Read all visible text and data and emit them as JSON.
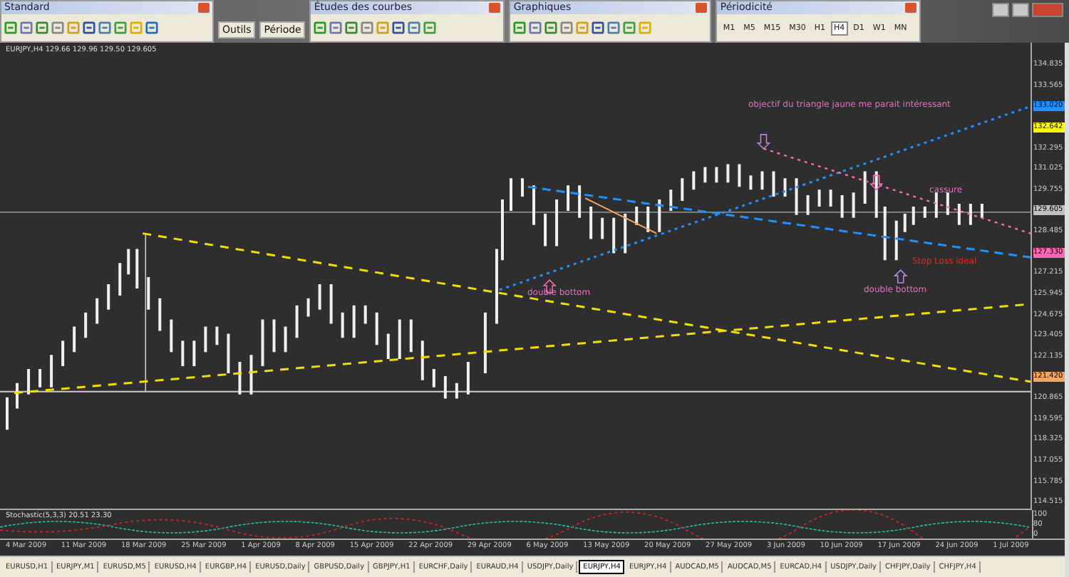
{
  "toolbars": [
    {
      "title": "Standard",
      "kind": "icons"
    },
    {
      "title": "Études des courbes",
      "kind": "icons"
    },
    {
      "title": "Graphiques",
      "kind": "icons"
    },
    {
      "title": "Périodicité",
      "kind": "periods",
      "periods": [
        {
          "label": "M1",
          "selected": false
        },
        {
          "label": "M5",
          "selected": false
        },
        {
          "label": "M15",
          "selected": false
        },
        {
          "label": "M30",
          "selected": false
        },
        {
          "label": "H1",
          "selected": false
        },
        {
          "label": "H4",
          "selected": true
        },
        {
          "label": "D1",
          "selected": false
        },
        {
          "label": "W1",
          "selected": false
        },
        {
          "label": "MN",
          "selected": false
        }
      ]
    }
  ],
  "menu_buttons": [
    "Outils",
    "Période"
  ],
  "chart": {
    "header": "EURJPY,H4 129.66 129.96 129.50 129.605",
    "annotations": [
      {
        "text": "objectif du triangle jaune me parait intéressant",
        "kind": "note"
      },
      {
        "text": "double bottom",
        "kind": "note"
      },
      {
        "text": "double bottom",
        "kind": "note"
      },
      {
        "text": "cassure",
        "kind": "note"
      },
      {
        "text": "Stop Loss ideal",
        "kind": "alert"
      }
    ],
    "price_axis": [
      {
        "label": "134.835"
      },
      {
        "label": "133.565"
      },
      {
        "label": "133.020",
        "color": "#1e90ff"
      },
      {
        "label": "132.642",
        "color": "#ffff00"
      },
      {
        "label": "132.295"
      },
      {
        "label": "131.025"
      },
      {
        "label": "129.755"
      },
      {
        "label": "129.605",
        "color": "#c0c0c0"
      },
      {
        "label": "128.485"
      },
      {
        "label": "127.330",
        "color": "#ff69b4"
      },
      {
        "label": "127.215"
      },
      {
        "label": "125.945"
      },
      {
        "label": "124.675"
      },
      {
        "label": "123.405"
      },
      {
        "label": "122.135"
      },
      {
        "label": "121.420",
        "color": "#f4a460"
      },
      {
        "label": "120.865"
      },
      {
        "label": "119.595"
      },
      {
        "label": "118.325"
      },
      {
        "label": "117.055"
      },
      {
        "label": "115.785"
      },
      {
        "label": "114.515"
      }
    ],
    "indicator_label": "Stochastic(5,3,3) 20.51 23.30",
    "indicator_axis": [
      "100",
      "80",
      "0"
    ],
    "time_axis": [
      "4 Mar 2009",
      "11 Mar 2009",
      "18 Mar 2009",
      "25 Mar 2009",
      "1 Apr 2009",
      "8 Apr 2009",
      "15 Apr 2009",
      "22 Apr 2009",
      "29 Apr 2009",
      "6 May 2009",
      "13 May 2009",
      "20 May 2009",
      "27 May 2009",
      "3 Jun 2009",
      "10 Jun 2009",
      "17 Jun 2009",
      "24 Jun 2009",
      "1 Jul 2009"
    ]
  },
  "tabs": [
    {
      "label": "EURUSD,H1",
      "selected": false
    },
    {
      "label": "EURJPY,M1",
      "selected": false
    },
    {
      "label": "EURUSD,M5",
      "selected": false
    },
    {
      "label": "EURUSD,H4",
      "selected": false
    },
    {
      "label": "EURGBP,H4",
      "selected": false
    },
    {
      "label": "EURUSD,Daily",
      "selected": false
    },
    {
      "label": "GBPUSD,Daily",
      "selected": false
    },
    {
      "label": "GBPJPY,H1",
      "selected": false
    },
    {
      "label": "EURCHF,Daily",
      "selected": false
    },
    {
      "label": "EURAUD,H4",
      "selected": false
    },
    {
      "label": "USDJPY,Daily",
      "selected": false
    },
    {
      "label": "EURJPY,H4",
      "selected": true
    },
    {
      "label": "EURJPY,H4",
      "selected": false
    },
    {
      "label": "AUDCAD,M5",
      "selected": false
    },
    {
      "label": "AUDCAD,M5",
      "selected": false
    },
    {
      "label": "EURCAD,H4",
      "selected": false
    },
    {
      "label": "USDJPY,Daily",
      "selected": false
    },
    {
      "label": "CHFJPY,Daily",
      "selected": false
    },
    {
      "label": "CHFJPY,H4",
      "selected": false
    }
  ]
}
